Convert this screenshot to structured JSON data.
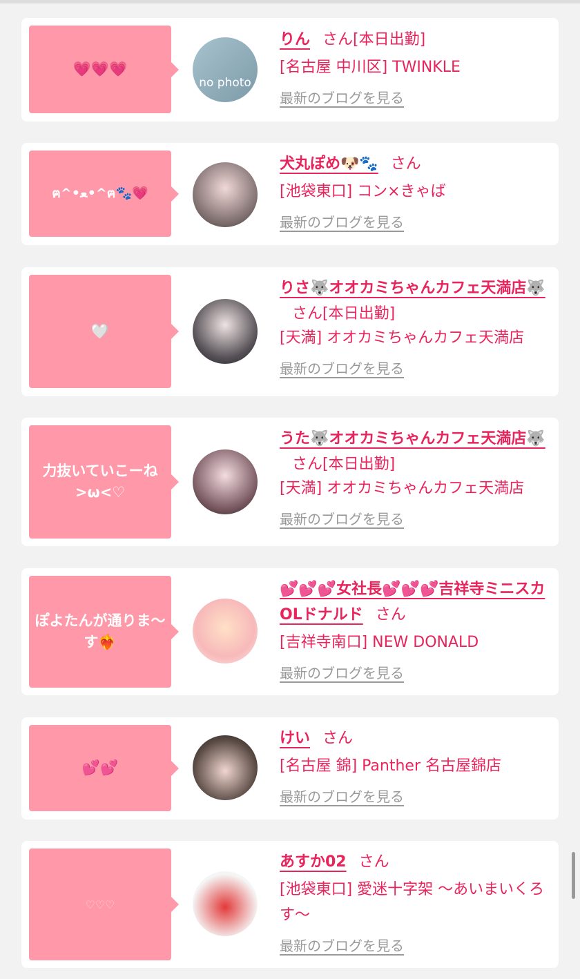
{
  "items": [
    {
      "bubble": "💗💗💗",
      "name": "りん",
      "san": "さん",
      "status": "[本日出勤]",
      "shop": "[名古屋 中川区] TWINKLE",
      "blog": "最新のブログを見る",
      "avatar_text": "no photo"
    },
    {
      "bubble": "ฅ^•ﻌ•^ฅ🐾💗",
      "name": "犬丸ぽめ🐶🐾",
      "san": "さん",
      "status": "",
      "shop": "[池袋東口] コン×きゃば",
      "blog": "最新のブログを見る"
    },
    {
      "bubble": "🤍",
      "name": "りさ🐺オオカミちゃんカフェ天満店🐺",
      "san": "さん",
      "status": "[本日出勤]",
      "shop": "[天満] オオカミちゃんカフェ天満店",
      "blog": "最新のブログを見る"
    },
    {
      "bubble": "力抜いていこーね >ω<♡",
      "name": "うた🐺オオカミちゃんカフェ天満店🐺",
      "san": "さん",
      "status": "[本日出勤]",
      "shop": "[天満] オオカミちゃんカフェ天満店",
      "blog": "最新のブログを見る"
    },
    {
      "bubble": "ぽよたんが通りま〜す❤️‍🔥",
      "name": "💕💕💕女社長💕💕💕吉祥寺ミニスカOLドナルド",
      "san": "さん",
      "status": "",
      "shop": "[吉祥寺南口] NEW DONALD",
      "blog": "最新のブログを見る"
    },
    {
      "bubble": "💕💕",
      "name": "けい",
      "san": "さん",
      "status": "",
      "shop": "[名古屋 錦] Panther 名古屋錦店",
      "blog": "最新のブログを見る"
    },
    {
      "bubble": "♡♡♡",
      "name": "あすか02",
      "san": "さん",
      "status": "",
      "shop": "[池袋東口] 愛迷十字架 〜あいまいくろす〜",
      "blog": "最新のブログを見る"
    }
  ]
}
